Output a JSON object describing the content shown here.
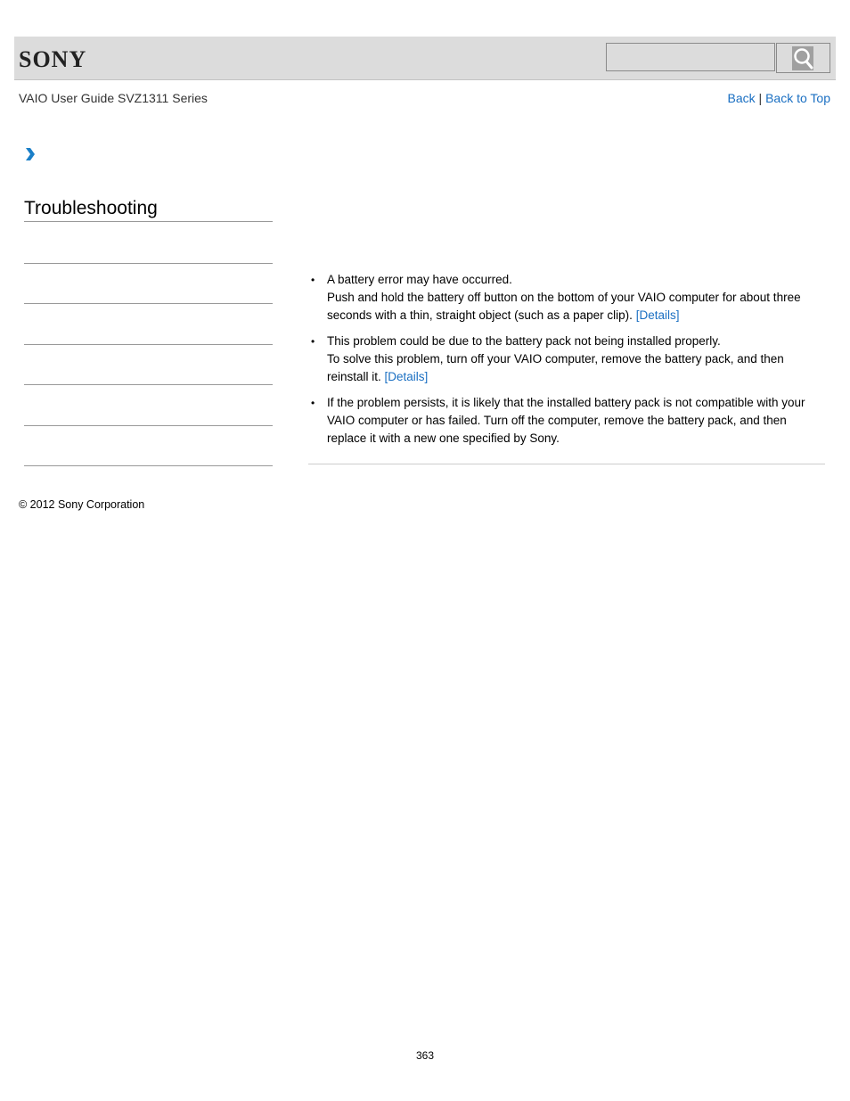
{
  "header": {
    "logo": "SONY",
    "search": {
      "placeholder": "",
      "value": ""
    },
    "search_button_icon": "search-icon"
  },
  "subheader": {
    "guide_title": "VAIO User Guide SVZ1311 Series",
    "nav": {
      "back": "Back",
      "separator": " | ",
      "back_to_top": "Back to Top"
    }
  },
  "breadcrumb": {
    "icon": "chevron-right-icon"
  },
  "sidebar": {
    "section_title": "Troubleshooting",
    "items": [
      "",
      "",
      "",
      "",
      "",
      ""
    ]
  },
  "content": {
    "items": [
      {
        "line1": "A battery error may have occurred.",
        "line2": "Push and hold the battery off button on the bottom of your VAIO computer for about three seconds with a thin, straight object (such as a paper clip). ",
        "link": "[Details]"
      },
      {
        "line1": "This problem could be due to the battery pack not being installed properly.",
        "line2": "To solve this problem, turn off your VAIO computer, remove the battery pack, and then reinstall it. ",
        "link": "[Details]"
      },
      {
        "line1": "If the problem persists, it is likely that the installed battery pack is not compatible with your VAIO computer or has failed. Turn off the computer, remove the battery pack, and then replace it with a new one specified by Sony."
      }
    ],
    "bullet": "•"
  },
  "footer": {
    "copyright": "© 2012 Sony Corporation",
    "page_number": "363"
  },
  "colors": {
    "link": "#1a6fc2",
    "header_bg": "#dcdcdc",
    "chevron": "#1a7fc8"
  }
}
